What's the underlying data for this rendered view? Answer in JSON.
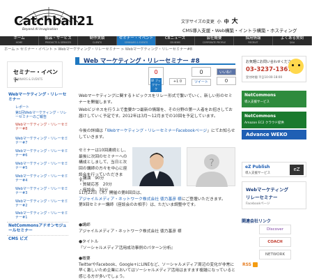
{
  "header": {
    "logo_text": "Catchball21",
    "logo_tagline": "Beyond AI Imagination",
    "font_size_label": "文字サイズの変更",
    "font_sizes": [
      "小",
      "中",
      "大"
    ],
    "tagline": "CMS導入支援・Web構築・イントラ構築・ホスティング"
  },
  "nav": [
    {
      "jp": "ホーム",
      "en": "HOME"
    },
    {
      "jp": "製品・サービス",
      "en": "PRODUCTS & SERVICES"
    },
    {
      "jp": "制作実績",
      "en": "CLIENTS"
    },
    {
      "jp": "セミナー・イベント",
      "en": "SEMINARS & EVENTS"
    },
    {
      "jp": "CBニュース",
      "en": "CB NEWS"
    },
    {
      "jp": "会社概要",
      "en": "CORPORATE PROFILE"
    },
    {
      "jp": "採用情報",
      "en": "RECRUIT"
    },
    {
      "jp": "よくある質問",
      "en": "Q&A"
    }
  ],
  "breadcrumb": "ホーム > セミナー・イベント > Webマーケティング・リレーセミナー > Webマーケティング・リレーセミナー#8",
  "left": {
    "banner_title": "セミナー・イベント",
    "banner_en": "SEMINARS & EVENTS",
    "items": [
      {
        "label": "Webマーケティング・リレーセミナー",
        "type": "head"
      },
      {
        "label": "レポート",
        "type": "sub"
      },
      {
        "label": "第1回Webマーケティング・リレーセミナーのご報告",
        "type": "sub"
      },
      {
        "label": "Webマーケティング・リレーセミナー#8",
        "type": "active"
      },
      {
        "label": "Webマーケティング・リレーセミナー#7",
        "type": "sub"
      },
      {
        "label": "Webマーケティング・リレーセミナー#6",
        "type": "sub"
      },
      {
        "label": "Webマーケティング・リレーセミナー#5",
        "type": "sub"
      },
      {
        "label": "Webマーケティング・リレーセミナー#4",
        "type": "sub"
      },
      {
        "label": "Webマーケティング・リレーセミナー#3",
        "type": "sub"
      },
      {
        "label": "Webマーケティング・リレーセミナー#2",
        "type": "sub"
      },
      {
        "label": "Webマーケティング・リレーセミナー#1",
        "type": "sub"
      },
      {
        "label": "NetCommonsアドオンモジュールセミナー",
        "type": "head"
      },
      {
        "label": "CMS ビズ",
        "type": "head"
      }
    ]
  },
  "main": {
    "title": "Web マーケティング・リレーセミナー #8",
    "share": {
      "hatena_count": "0",
      "hatena_label": "B! ブックマーク",
      "gplus": "+1 0",
      "tweet_count": "0",
      "tweet_label": "ツイート",
      "fb_like": "いいね！",
      "fb_count": "0"
    },
    "para1": "Webマーケティングに関するトピックスをリレー形式で繋いでいく、新しい形のセミナーを開催します。",
    "para2": "Webビジネスを行う上で重要かつ最新の情報を、その分野の第一人者をお招きしてお届けしていく予定です。2012年は3月〜12月までの10回を予定しています。",
    "para3a": "今後の詳細は「",
    "para3_link": "Webマーケティング・リレーセミナーFacebookページ",
    "para3b": "」にてお知らせしていきます。",
    "para4": "セミナーは10回連続とし、最後に次回のセミナーへの構成としまして、当日と次回の講師の方々を中心に座談会を行っていただきます。",
    "schedule": [
      "・講演　90分",
      "・質疑応答　20分",
      "・座談会　30分"
    ],
    "para5": "11月22日（木）開催の第8回目は、",
    "speaker_link": "アジャイルメディア・ネットワーク株式会社 徳力基彦 様",
    "para5b": "にご登壇いただきます。",
    "para6": "第9回セミナー講師（座談会のお相手）は、ただいま調整中です。",
    "lecturer_head": "●講師",
    "lecturer": "アジャイルメディア・ネットワーク株式会社 徳力基彦 様",
    "title_head": "●タイトル",
    "talk_title": "『ソーシャルメディア活用成功事例のパターン分析』",
    "summary_head": "●概要",
    "summary": "TwitterやFacebook、Google+にLINEなど、ソーシャルメディア周辺の変化が非常に早く激しいため企業においてはソーシャルメディア活用はますます複雑になっていると感じる方が多いでしょう。"
  },
  "right": {
    "contact_l1": "お気軽にお問い合わせください",
    "contact_phone": "03-3237-1367",
    "contact_l3": "受付時間 平日10:00-18:00",
    "nc1_title": "NetCommons",
    "nc1_sub": "導入支援サービス",
    "nc2_title": "NetCommons",
    "nc2_sub": "Amazon EC2 クラウド提供",
    "advance": "Advance WEKO",
    "ez_title": "eZ Publish",
    "ez_sub": "導入支援サービス",
    "ez_logo": "eZ",
    "relay_t1": "Webマーケティング",
    "relay_t2": "リレーセミナー",
    "relay_t3": "Facebookページ",
    "related_title": "関連会社リンク",
    "related": [
      "Discover",
      "COACH",
      "NETWORK"
    ],
    "rss": "RSS"
  }
}
